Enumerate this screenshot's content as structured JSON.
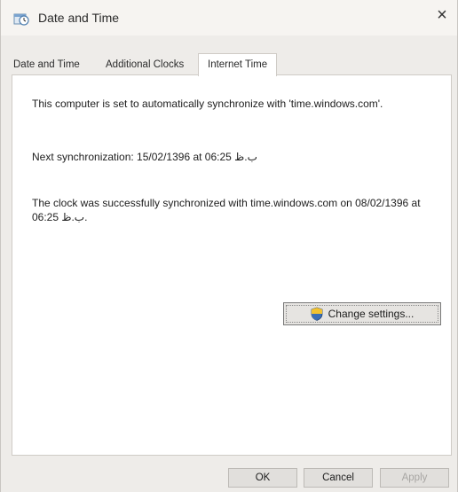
{
  "window": {
    "title": "Date and Time",
    "close_glyph": "×"
  },
  "tabs": [
    {
      "label": "Date and Time",
      "selected": false
    },
    {
      "label": "Additional Clocks",
      "selected": false
    },
    {
      "label": "Internet Time",
      "selected": true
    }
  ],
  "internet_time": {
    "auto_sync_text": "This computer is set to automatically synchronize with 'time.windows.com'.",
    "next_sync_text": "Next synchronization: 15/02/1396 at 06:25 ب.ظ",
    "last_sync_text": "The clock was successfully synchronized with time.windows.com on 08/02/1396 at 06:25 ب.ظ.",
    "change_settings_label": "Change settings..."
  },
  "footer": {
    "ok_label": "OK",
    "cancel_label": "Cancel",
    "apply_label": "Apply",
    "apply_enabled": false
  },
  "icons": {
    "title": "clock-calendar-icon",
    "change_settings": "uac-shield-icon",
    "close": "close-icon"
  }
}
